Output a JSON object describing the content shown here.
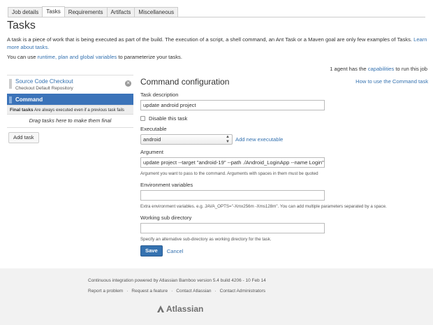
{
  "tabs": [
    {
      "label": "Job details"
    },
    {
      "label": "Tasks"
    },
    {
      "label": "Requirements"
    },
    {
      "label": "Artifacts"
    },
    {
      "label": "Miscellaneous"
    }
  ],
  "page": {
    "title": "Tasks",
    "intro": "A task is a piece of work that is being executed as part of the build. The execution of a script, a shell command, an Ant Task or a Maven goal are only few examples of Tasks.",
    "intro_link": "Learn more about tasks.",
    "vars_prefix": "You can use",
    "vars_link": "runtime, plan and global variables",
    "vars_suffix": "to parameterize your tasks.",
    "agents_prefix": "1 agent has the",
    "agents_link": "capabilities",
    "agents_suffix": "to run this job"
  },
  "task_list": {
    "items": [
      {
        "name": "Source Code Checkout",
        "description": "Checkout Default Repository"
      },
      {
        "name": "Command"
      }
    ],
    "final_label": "Final tasks",
    "final_note": "Are always executed even if a previous task fails",
    "drag_hint": "Drag tasks here to make them final",
    "add_button": "Add task"
  },
  "config": {
    "title": "Command configuration",
    "howto_link": "How to use the Command task",
    "task_description_label": "Task description",
    "task_description_value": "update android project",
    "disable_label": "Disable this task",
    "executable_label": "Executable",
    "executable_value": "android",
    "add_executable_link": "Add new executable",
    "argument_label": "Argument",
    "argument_value": "update project --target \"android-19\" --path ./Android_LoginApp --name Login\"",
    "argument_help": "Argument you want to pass to the command. Arguments with spaces in them must be quoted",
    "env_label": "Environment variables",
    "env_value": "",
    "env_help": "Extra environment variables. e.g. JAVA_OPTS=\"-Xmx256m -Xms128m\". You can add multiple parameters separated by a space.",
    "workdir_label": "Working sub directory",
    "workdir_value": "",
    "workdir_help": "Specify an alternative sub-directory as working directory for the task.",
    "save_label": "Save",
    "cancel_label": "Cancel"
  },
  "footer": {
    "powered": "Continuous integration powered by Atlassian Bamboo version 5.4 build 4206 - 10 Feb 14",
    "links": [
      "Report a problem",
      "Request a feature",
      "Contact Atlassian",
      "Contact Administrators"
    ],
    "logo_text": "Atlassian"
  },
  "colors": {
    "link": "#3572b0",
    "selected": "#3b73b9",
    "footer_bg": "#f2f2f2"
  }
}
